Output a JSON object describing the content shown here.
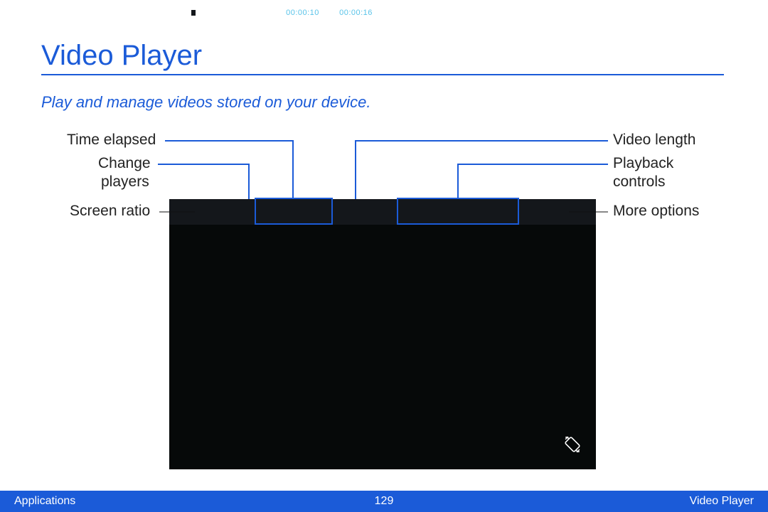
{
  "page": {
    "title": "Video Player",
    "subtitle": "Play and manage videos stored on your device."
  },
  "labels": {
    "time_elapsed": "Time elapsed",
    "change_players": "Change",
    "change_players2": "players",
    "screen_ratio": "Screen ratio",
    "video_length": "Video length",
    "playback_controls": "Playback",
    "playback_controls2": "controls",
    "more_options": "More options"
  },
  "player": {
    "elapsed": "00:00:10",
    "length": "00:00:16"
  },
  "footer": {
    "left": "Applications",
    "page_num": "129",
    "right": "Video Player"
  }
}
